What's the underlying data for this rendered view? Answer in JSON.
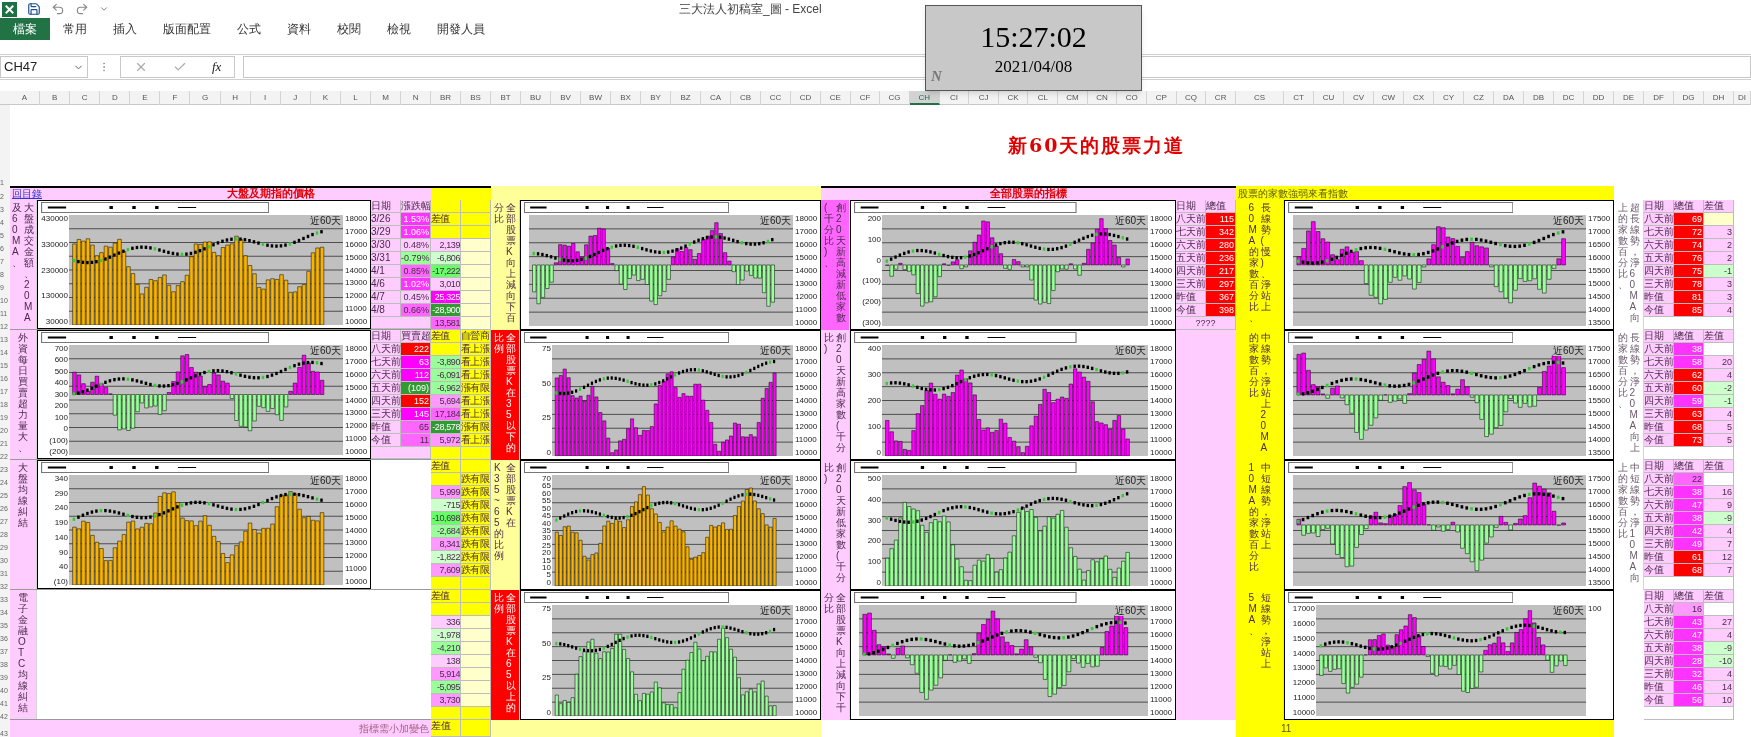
{
  "window": {
    "title": "三大法人初稿室_圖 - Excel"
  },
  "tabs": [
    {
      "label": "檔案",
      "selected": true
    },
    {
      "label": "常用",
      "selected": false
    },
    {
      "label": "插入",
      "selected": false
    },
    {
      "label": "版面配置",
      "selected": false
    },
    {
      "label": "公式",
      "selected": false
    },
    {
      "label": "資料",
      "selected": false
    },
    {
      "label": "校閱",
      "selected": false
    },
    {
      "label": "檢視",
      "selected": false
    },
    {
      "label": "開發人員",
      "selected": false
    }
  ],
  "formula_bar": {
    "name_box": "CH47",
    "fx": "fx"
  },
  "clock": {
    "time": "15:27:02",
    "date": "2021/04/08",
    "mark": "N"
  },
  "column_groups": [
    [
      {
        "label": "A",
        "selected": false
      },
      {
        "label": "B",
        "selected": false
      },
      {
        "label": "C",
        "selected": false
      },
      {
        "label": "D",
        "selected": false
      },
      {
        "label": "E",
        "selected": false
      },
      {
        "label": "F",
        "selected": false
      },
      {
        "label": "G",
        "selected": false
      },
      {
        "label": "H",
        "selected": false
      },
      {
        "label": "I",
        "selected": false
      },
      {
        "label": "J",
        "selected": false
      },
      {
        "label": "K",
        "selected": false
      },
      {
        "label": "L",
        "selected": false
      },
      {
        "label": "M",
        "selected": false
      },
      {
        "label": "N",
        "selected": false
      }
    ],
    [
      {
        "label": "BR",
        "selected": false
      },
      {
        "label": "BS",
        "selected": false
      }
    ],
    [
      {
        "label": "BT",
        "selected": false
      },
      {
        "label": "BU",
        "selected": false
      },
      {
        "label": "BV",
        "selected": false
      },
      {
        "label": "BW",
        "selected": false
      },
      {
        "label": "BX",
        "selected": false
      },
      {
        "label": "BY",
        "selected": false
      },
      {
        "label": "BZ",
        "selected": false
      },
      {
        "label": "CA",
        "selected": false
      },
      {
        "label": "CB",
        "selected": false
      },
      {
        "label": "CC",
        "selected": false
      },
      {
        "label": "CD",
        "selected": false
      }
    ],
    [
      {
        "label": "CE",
        "selected": false
      },
      {
        "label": "CF",
        "selected": false
      },
      {
        "label": "CG",
        "selected": false
      },
      {
        "label": "CH",
        "selected": true
      },
      {
        "label": "CI",
        "selected": false
      },
      {
        "label": "CJ",
        "selected": false
      },
      {
        "label": "CK",
        "selected": false
      },
      {
        "label": "CL",
        "selected": false
      },
      {
        "label": "CM",
        "selected": false
      },
      {
        "label": "CN",
        "selected": false
      },
      {
        "label": "CO",
        "selected": false
      },
      {
        "label": "CP",
        "selected": false
      },
      {
        "label": "CQ",
        "selected": false
      },
      {
        "label": "CR",
        "selected": false
      }
    ],
    [
      {
        "label": "CS",
        "selected": false
      },
      {
        "label": "CT",
        "selected": false
      },
      {
        "label": "CU",
        "selected": false
      },
      {
        "label": "CV",
        "selected": false
      },
      {
        "label": "CW",
        "selected": false
      },
      {
        "label": "CX",
        "selected": false
      },
      {
        "label": "CY",
        "selected": false
      },
      {
        "label": "CZ",
        "selected": false
      },
      {
        "label": "DA",
        "selected": false
      },
      {
        "label": "DB",
        "selected": false
      },
      {
        "label": "DC",
        "selected": false
      },
      {
        "label": "DD",
        "selected": false
      }
    ],
    [
      {
        "label": "DE",
        "selected": false
      },
      {
        "label": "DF",
        "selected": false
      },
      {
        "label": "DG",
        "selected": false
      },
      {
        "label": "DH",
        "selected": false
      }
    ],
    [
      {
        "label": "DI",
        "selected": false
      }
    ]
  ],
  "row_numbers": [
    "1",
    "2",
    "3",
    "4",
    "5",
    "6",
    "7",
    "8",
    "9",
    "10",
    "11",
    "12",
    "13",
    "14",
    "15",
    "16",
    "17",
    "18",
    "19",
    "20",
    "21",
    "22",
    "23",
    "24",
    "25",
    "26",
    "27",
    "28",
    "29",
    "30",
    "31",
    "32",
    "33",
    "34",
    "35",
    "36",
    "37",
    "38",
    "39",
    "40",
    "41",
    "42",
    "43"
  ],
  "sheet_title": "新60天的股票力道",
  "market": {
    "link": "回目錄",
    "title": "大盤及期指的價格",
    "note": "指標需小加變色",
    "panels": [
      {
        "label": {
          "lines": [
            "及60MA、",
            "大盤成交金額、20MA"
          ],
          "color": "#ffccff"
        },
        "chart": {
          "kind": "volume",
          "period": "近60天",
          "left_ticks": [
            "430000",
            "330000",
            "230000",
            "130000",
            "30000"
          ],
          "right_ticks": [
            "18000",
            "17000",
            "16000",
            "15000",
            "14000",
            "13000",
            "12000",
            "11000",
            "10000"
          ]
        },
        "table": {
          "columns": [
            "日期",
            "漲跌幅"
          ],
          "rows": [
            {
              "date": "3/26",
              "value": "1.53%",
              "color": "#ff33ff"
            },
            {
              "date": "3/29",
              "value": "1.06%",
              "color": "#ff33ff"
            },
            {
              "date": "3/30",
              "value": "0.48%",
              "color": "#ffccff"
            },
            {
              "date": "3/31",
              "value": "-0.79%",
              "color": "#99ff99"
            },
            {
              "date": "4/1",
              "value": "0.85%",
              "color": "#ff66ff"
            },
            {
              "date": "4/6",
              "value": "1.02%",
              "color": "#ff33ff"
            },
            {
              "date": "4/7",
              "value": "0.45%",
              "color": "#ffccff"
            },
            {
              "date": "4/8",
              "value": "0.66%",
              "color": "#ff66ff"
            }
          ]
        }
      },
      {
        "label": {
          "lines": [
            "外資每日買賣超力量大、"
          ],
          "color": "#ffccff"
        },
        "chart": {
          "kind": "split",
          "period": "近60天",
          "left_ticks": [
            "700",
            "600",
            "500",
            "400",
            "300",
            "200",
            "100",
            "0",
            "(100)",
            "(200)"
          ],
          "right_ticks": [
            "18000",
            "17000",
            "16000",
            "15000",
            "14000",
            "13000",
            "12000",
            "11000",
            "10000"
          ]
        },
        "table": {
          "columns": [
            "日期",
            "買賣超"
          ],
          "rows": [
            {
              "date": "八天前",
              "value": "222",
              "color": "#ff0000"
            },
            {
              "date": "七天前",
              "value": "63",
              "color": "#ff00ff"
            },
            {
              "date": "六天前",
              "value": "112",
              "color": "#ff00ff"
            },
            {
              "date": "五天前",
              "value": "(109)",
              "color": "#339933"
            },
            {
              "date": "四天前",
              "value": "152",
              "color": "#ff0000"
            },
            {
              "date": "三天前",
              "value": "145",
              "color": "#ff00ff"
            },
            {
              "date": "昨值",
              "value": "65",
              "color": "#ff66ff"
            },
            {
              "date": "今值",
              "value": "11",
              "color": "#ff66ff"
            }
          ]
        }
      },
      {
        "label": {
          "lines": [
            "大盤均線糾結"
          ],
          "color": "#ffccff"
        },
        "chart": {
          "kind": "volume",
          "period": "近60天",
          "left_ticks": [
            "340",
            "290",
            "240",
            "190",
            "140",
            "90",
            "40",
            "(10)"
          ],
          "right_ticks": [
            "18000",
            "17000",
            "16000",
            "15000",
            "14000",
            "13000",
            "12000",
            "11000",
            "10000"
          ]
        }
      },
      {
        "label": {
          "lines": [
            "電子金融OTC均線糾結"
          ],
          "color": "#ffccff"
        }
      }
    ]
  },
  "futures": {
    "panels": [
      {
        "br": [
          {
            "color": "#ffff00"
          },
          {
            "text": "差值",
            "color": "#ffff00"
          },
          {
            "color": "#ffff00"
          },
          {
            "text": "2,139",
            "color": "#ffccff"
          },
          {
            "text": "-6,806",
            "color": "#ccffcc"
          },
          {
            "text": "-17,222",
            "color": "#66ff66"
          },
          {
            "text": "3,010",
            "color": "#ffccff"
          },
          {
            "text": "25,325",
            "color": "#ff00ff"
          },
          {
            "text": "-28,900",
            "color": "#339933"
          },
          {
            "text": "13,581",
            "color": "#ff66ff"
          }
        ],
        "bs": [
          {
            "color": "#ffff00"
          },
          {
            "color": "#ffff00"
          },
          {
            "color": "#ffff00"
          },
          {
            "color": "#ffffcc"
          },
          {
            "color": "#ffffcc"
          },
          {
            "color": "#ffffcc"
          },
          {
            "color": "#ffffcc"
          },
          {
            "color": "#ffffcc"
          },
          {
            "color": "#ffffcc"
          },
          {
            "color": "#ffffcc"
          }
        ]
      },
      {
        "br": [
          {
            "text": "差值",
            "color": "#ffff00"
          },
          {
            "color": "#ffff00"
          },
          {
            "text": "-3,890",
            "color": "#99ff99"
          },
          {
            "text": "-6,091",
            "color": "#99ff99"
          },
          {
            "text": "-6,962",
            "color": "#99ff99"
          },
          {
            "text": "5,694",
            "color": "#ff99ff"
          },
          {
            "text": "17,184",
            "color": "#ff66ff"
          },
          {
            "text": "-28,578",
            "color": "#339933"
          },
          {
            "text": "5,972",
            "color": "#ff99ff"
          },
          {
            "color": "#ffff00"
          }
        ],
        "bs": [
          {
            "text": "自營商",
            "color": "#ffff00"
          },
          {
            "text": "看上漲",
            "color": "#ffff00"
          },
          {
            "text": "看上漲",
            "color": "#ffff00"
          },
          {
            "text": "看上漲",
            "color": "#ffff00"
          },
          {
            "text": "漲有限",
            "color": "#ffff00"
          },
          {
            "text": "看上漲",
            "color": "#ffff00"
          },
          {
            "text": "看上漲",
            "color": "#ffff00"
          },
          {
            "text": "漲有限",
            "color": "#ffff00"
          },
          {
            "text": "看上漲",
            "color": "#ffff00"
          },
          {
            "color": "#ffff00"
          }
        ]
      },
      {
        "br": [
          {
            "text": "差值",
            "color": "#ffff00"
          },
          {
            "color": "#ffff00"
          },
          {
            "text": "5,999",
            "color": "#ff99ff"
          },
          {
            "text": "-715",
            "color": "#ccffcc"
          },
          {
            "text": "-10,698",
            "color": "#66ff66"
          },
          {
            "text": "-2,684",
            "color": "#99ff99"
          },
          {
            "text": "8,341",
            "color": "#ff99ff"
          },
          {
            "text": "-1,822",
            "color": "#ccffcc"
          },
          {
            "text": "7,609",
            "color": "#ff99ff"
          },
          {
            "color": "#ffff00"
          }
        ],
        "bs": [
          {
            "color": "#ffff00"
          },
          {
            "text": "跌有限",
            "color": "#ffff00"
          },
          {
            "text": "跌有限",
            "color": "#ffff00"
          },
          {
            "text": "跌有限",
            "color": "#ffff00"
          },
          {
            "text": "跌有限",
            "color": "#ffff00"
          },
          {
            "text": "跌有限",
            "color": "#ffff00"
          },
          {
            "text": "跌有限",
            "color": "#ffff00"
          },
          {
            "text": "跌有限",
            "color": "#ffff00"
          },
          {
            "text": "跌有限",
            "color": "#ffff00"
          },
          {
            "color": "#ffff00"
          }
        ]
      },
      {
        "br": [
          {
            "text": "差值",
            "color": "#ffff00"
          },
          {
            "color": "#ffff00"
          },
          {
            "text": "336",
            "color": "#ffccff"
          },
          {
            "text": "-1,978",
            "color": "#ccffcc"
          },
          {
            "text": "-4,210",
            "color": "#99ff99"
          },
          {
            "text": "138",
            "color": "#ffccff"
          },
          {
            "text": "5,914",
            "color": "#ff99ff"
          },
          {
            "text": "-5,095",
            "color": "#99ff99"
          },
          {
            "text": "3,730",
            "color": "#ff99ff"
          },
          {
            "color": "#ffff00"
          }
        ],
        "bs": [
          {
            "color": "#ffff00"
          },
          {
            "color": "#ffff00"
          },
          {
            "color": "#ffffcc"
          },
          {
            "color": "#ffffcc"
          },
          {
            "color": "#ffffcc"
          },
          {
            "color": "#ffffcc"
          },
          {
            "color": "#ffffcc"
          },
          {
            "color": "#ffffcc"
          },
          {
            "color": "#ffffcc"
          },
          {
            "color": "#ffff00"
          }
        ]
      }
    ],
    "footer": [
      {
        "text": "差值",
        "color": "#ffff00"
      },
      {
        "color": "#ffff00"
      }
    ]
  },
  "k_ratio": {
    "panels": [
      {
        "label": {
          "lines": [
            "分比",
            "全部股票K向上減向下百"
          ],
          "color": "#ffff99"
        },
        "chart": {
          "kind": "split",
          "period": "近60天",
          "right_ticks": [
            "18000",
            "17000",
            "16000",
            "15000",
            "14000",
            "13000",
            "12000",
            "11000",
            "10000"
          ]
        }
      },
      {
        "label": {
          "lines": [
            "比例",
            "全部股票K在35以下的"
          ],
          "color": "#ff0000"
        },
        "chart": {
          "kind": "up",
          "period": "近60天",
          "left_ticks": [
            "75",
            "50",
            "25",
            "0"
          ],
          "right_ticks": [
            "18000",
            "17000",
            "16000",
            "15000",
            "14000",
            "13000",
            "12000",
            "11000",
            "10000"
          ]
        }
      },
      {
        "label": {
          "lines": [
            "K35~65的比例",
            "全部股票K在"
          ],
          "color": "#ffff99"
        },
        "chart": {
          "kind": "volume",
          "period": "近60天",
          "left_ticks": [
            "70",
            "65",
            "60",
            "55",
            "50",
            "45",
            "40",
            "35",
            "30",
            "25",
            "20",
            "15",
            "10",
            "5",
            "0"
          ],
          "right_ticks": [
            "18000",
            "17000",
            "16000",
            "15000",
            "14000",
            "13000",
            "12000",
            "11000",
            "10000"
          ]
        }
      },
      {
        "label": {
          "lines": [
            "比例",
            "全部股票K在65以上的"
          ],
          "color": "#ff0000"
        },
        "chart": {
          "kind": "down",
          "period": "近60天",
          "left_ticks": [
            "75",
            "50",
            "25",
            "0"
          ],
          "right_ticks": [
            "18000",
            "17000",
            "16000",
            "15000",
            "14000",
            "13000",
            "12000",
            "11000",
            "10000"
          ]
        }
      }
    ]
  },
  "new_high_low": {
    "title": "全部股票的指標",
    "panels": [
      {
        "label": {
          "lines": [
            "(千分比)、",
            "創20天新高減新低家數"
          ],
          "color": "#ff66ff"
        },
        "chart": {
          "kind": "split",
          "period": "近60天",
          "left_ticks": [
            "200",
            "100",
            "0",
            "(100)",
            "(200)",
            "(300)"
          ],
          "right_ticks": [
            "18000",
            "17000",
            "16000",
            "15000",
            "14000",
            "13000",
            "12000",
            "11000",
            "10000"
          ]
        },
        "table": {
          "columns": [
            "日期",
            "總值"
          ],
          "note": "????",
          "rows": [
            {
              "date": "八天前",
              "value": "115",
              "color": "#ff0000"
            },
            {
              "date": "七天前",
              "value": "342",
              "color": "#ff0000"
            },
            {
              "date": "六天前",
              "value": "280",
              "color": "#ff0000"
            },
            {
              "date": "五天前",
              "value": "236",
              "color": "#ff0000"
            },
            {
              "date": "四天前",
              "value": "217",
              "color": "#ff0000"
            },
            {
              "date": "三天前",
              "value": "297",
              "color": "#ff0000"
            },
            {
              "date": "昨值",
              "value": "367",
              "color": "#ff0000"
            },
            {
              "date": "今值",
              "value": "398",
              "color": "#ff0000"
            }
          ]
        }
      },
      {
        "label": {
          "lines": [
            "比)",
            "創20天新高家數(千分"
          ],
          "color": "#ffccff"
        },
        "chart": {
          "kind": "up",
          "period": "近60天",
          "left_ticks": [
            "400",
            "300",
            "200",
            "100",
            "0"
          ],
          "right_ticks": [
            "18000",
            "17000",
            "16000",
            "15000",
            "14000",
            "13000",
            "12000",
            "11000",
            "10000"
          ]
        }
      },
      {
        "label": {
          "lines": [
            "比)",
            "創20天新低家數(千分"
          ],
          "color": "#ffccff"
        },
        "chart": {
          "kind": "down",
          "period": "近60天",
          "left_ticks": [
            "500",
            "400",
            "300",
            "200",
            "100",
            "0"
          ],
          "right_ticks": [
            "18000",
            "17000",
            "16000",
            "15000",
            "14000",
            "13000",
            "12000",
            "11000",
            "10000"
          ]
        }
      },
      {
        "label": {
          "lines": [
            "分比",
            "全部股票K向上減向下千"
          ],
          "color": "#ffccff"
        },
        "chart": {
          "kind": "split",
          "period": "近60天",
          "right_ticks": [
            "18000",
            "17000",
            "16000",
            "15000",
            "14000",
            "13000",
            "12000",
            "11000",
            "10000"
          ]
        }
      }
    ]
  },
  "ma_breadth": {
    "title": "股票的家數強弱來看指數",
    "footer": "11",
    "panels": [
      {
        "label": {
          "lines": [
            "60MA的家數百分比、",
            "長線勢(慢)、淨站上"
          ],
          "color": "#ffff00"
        },
        "chart": {
          "kind": "split",
          "period": "近60天",
          "right_ticks": [
            "17500",
            "17000",
            "16500",
            "16000",
            "15500",
            "15000",
            "14500",
            "14000",
            "13500"
          ]
        }
      },
      {
        "label": {
          "lines": [
            "的家數百分比",
            "中線勢，淨站上20MA"
          ],
          "color": "#ffff00"
        },
        "chart": {
          "kind": "split",
          "period": "近60天",
          "right_ticks": [
            "17500",
            "17000",
            "16500",
            "16000",
            "15500",
            "15000",
            "14500",
            "14000",
            "13500"
          ]
        }
      },
      {
        "label": {
          "lines": [
            "10MA的家數百分比",
            "中短線勢，淨站上"
          ],
          "color": "#ffff00"
        },
        "chart": {
          "kind": "split",
          "period": "近60天",
          "right_ticks": [
            "17500",
            "17000",
            "16500",
            "16000",
            "15500",
            "15000",
            "14500",
            "14000",
            "13500"
          ]
        }
      },
      {
        "label": {
          "lines": [
            "5MA、",
            "短線勢，淨站上"
          ],
          "color": "#ffff00"
        },
        "chart": {
          "kind": "split",
          "period": "近60天",
          "left_ticks": [
            "17000",
            "16000",
            "15000",
            "14000",
            "13000",
            "12000",
            "11000",
            "10000"
          ],
          "right_ticks": [
            "100"
          ]
        }
      }
    ]
  },
  "ma_tables": {
    "panels": [
      {
        "label": {
          "lines": [
            "上的家數百分比、",
            "超長線勢，淨60MA向"
          ]
        },
        "table": {
          "columns": [
            "日期",
            "總值",
            "差值"
          ],
          "rows": [
            {
              "date": "八天前",
              "value": "69",
              "color": "#ff0000",
              "diff": {
                "color": "#ffffcc"
              }
            },
            {
              "date": "七天前",
              "value": "72",
              "color": "#ff0000",
              "diff": {
                "text": "3",
                "color": "#ffccff"
              }
            },
            {
              "date": "六天前",
              "value": "74",
              "color": "#ff0000",
              "diff": {
                "text": "2",
                "color": "#ffccff"
              }
            },
            {
              "date": "五天前",
              "value": "76",
              "color": "#ff0000",
              "diff": {
                "text": "2",
                "color": "#ffccff"
              }
            },
            {
              "date": "四天前",
              "value": "75",
              "color": "#ff0000",
              "diff": {
                "text": "-1",
                "color": "#ccffcc"
              }
            },
            {
              "date": "三天前",
              "value": "78",
              "color": "#ff0000",
              "diff": {
                "text": "3",
                "color": "#ffccff"
              }
            },
            {
              "date": "昨值",
              "value": "81",
              "color": "#ff0000",
              "diff": {
                "text": "3",
                "color": "#ffccff"
              }
            },
            {
              "date": "今值",
              "value": "85",
              "color": "#ff0000",
              "diff": {
                "text": "4",
                "color": "#ffccff"
              }
            }
          ]
        }
      },
      {
        "label": {
          "lines": [
            "的家數百分比、",
            "長線勢，淨20MA向上"
          ]
        },
        "table": {
          "columns": [
            "日期",
            "總值",
            "差值"
          ],
          "rows": [
            {
              "date": "八天前",
              "value": "38",
              "color": "#ff33ff"
            },
            {
              "date": "七天前",
              "value": "58",
              "color": "#ff33ff",
              "diff": {
                "text": "20",
                "color": "#ffccff"
              }
            },
            {
              "date": "六天前",
              "value": "62",
              "color": "#ff0000",
              "diff": {
                "text": "4",
                "color": "#ffccff"
              }
            },
            {
              "date": "五天前",
              "value": "60",
              "color": "#ff0000",
              "diff": {
                "text": "-2",
                "color": "#ccffcc"
              }
            },
            {
              "date": "四天前",
              "value": "59",
              "color": "#ff33ff",
              "diff": {
                "text": "-1",
                "color": "#ccffcc"
              }
            },
            {
              "date": "三天前",
              "value": "63",
              "color": "#ff0000",
              "diff": {
                "text": "4",
                "color": "#ffccff"
              }
            },
            {
              "date": "昨值",
              "value": "68",
              "color": "#ff0000",
              "diff": {
                "text": "5",
                "color": "#ffccff"
              }
            },
            {
              "date": "今值",
              "value": "73",
              "color": "#ff0000",
              "diff": {
                "text": "5",
                "color": "#ffccff"
              }
            }
          ]
        }
      },
      {
        "label": {
          "lines": [
            "上的家數百分比",
            "中短線勢，淨10MA向"
          ]
        },
        "table": {
          "columns": [
            "日期",
            "總值",
            "差值"
          ],
          "rows": [
            {
              "date": "八天前",
              "value": "22",
              "color": "#ff66ff"
            },
            {
              "date": "七天前",
              "value": "38",
              "color": "#ff33ff",
              "diff": {
                "text": "16",
                "color": "#ffccff"
              }
            },
            {
              "date": "六天前",
              "value": "47",
              "color": "#ff33ff",
              "diff": {
                "text": "9",
                "color": "#ffccff"
              }
            },
            {
              "date": "五天前",
              "value": "38",
              "color": "#ff33ff",
              "diff": {
                "text": "-9",
                "color": "#ccffcc"
              }
            },
            {
              "date": "四天前",
              "value": "42",
              "color": "#ff33ff",
              "diff": {
                "text": "4",
                "color": "#ffccff"
              }
            },
            {
              "date": "三天前",
              "value": "49",
              "color": "#ff33ff",
              "diff": {
                "text": "7",
                "color": "#ffccff"
              }
            },
            {
              "date": "昨值",
              "value": "61",
              "color": "#ff0000",
              "diff": {
                "text": "12",
                "color": "#ffccff"
              }
            },
            {
              "date": "今值",
              "value": "68",
              "color": "#ff0000",
              "diff": {
                "text": "7",
                "color": "#ffccff"
              }
            }
          ]
        }
      },
      {
        "table": {
          "columns": [
            "日期",
            "總值",
            "差值"
          ],
          "rows": [
            {
              "date": "八天前",
              "value": "16",
              "color": "#ff99ff"
            },
            {
              "date": "七天前",
              "value": "43",
              "color": "#ff33ff",
              "diff": {
                "text": "27",
                "color": "#ffccff"
              }
            },
            {
              "date": "六天前",
              "value": "47",
              "color": "#ff33ff",
              "diff": {
                "text": "4",
                "color": "#ffccff"
              }
            },
            {
              "date": "五天前",
              "value": "38",
              "color": "#ff33ff",
              "diff": {
                "text": "-9",
                "color": "#ccffcc"
              }
            },
            {
              "date": "四天前",
              "value": "28",
              "color": "#ff33ff",
              "diff": {
                "text": "-10",
                "color": "#ccffcc"
              }
            },
            {
              "date": "三天前",
              "value": "32",
              "color": "#ff33ff",
              "diff": {
                "text": "4",
                "color": "#ffccff"
              }
            },
            {
              "date": "昨值",
              "value": "46",
              "color": "#ff33ff",
              "diff": {
                "text": "14",
                "color": "#ffccff"
              }
            },
            {
              "date": "今值",
              "value": "56",
              "color": "#ff33ff",
              "diff": {
                "text": "10",
                "color": "#ffccff"
              }
            }
          ]
        }
      }
    ]
  }
}
